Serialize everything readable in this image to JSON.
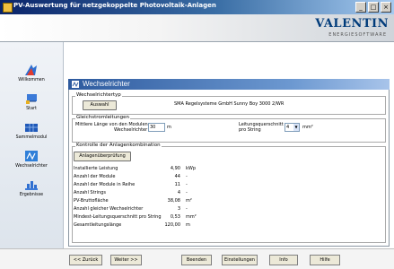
{
  "window": {
    "title": "PV-Auswertung für netzgekoppelte Photovoltaik-Anlagen"
  },
  "brand": {
    "logo": "VALENTIN",
    "tagline": "ENERGIESOFTWARE"
  },
  "sidebar": {
    "items": [
      {
        "label": "Willkommen",
        "icon": "welcome-icon"
      },
      {
        "label": "Start",
        "icon": "start-icon"
      },
      {
        "label": "Sammelmodul",
        "icon": "module-icon"
      },
      {
        "label": "Wechselrichter",
        "icon": "inverter-icon"
      },
      {
        "label": "Ergebnisse",
        "icon": "results-icon"
      }
    ]
  },
  "main": {
    "title": "Wechselrichter",
    "inverter_type": {
      "group_label": "Wechselrichtertyp",
      "select_button": "Auswahl",
      "selected_text": "SMA Regelsysteme GmbH Sunny Boy 3000 2/WR"
    },
    "cable": {
      "group_label": "Gleichstromleitungen",
      "length_label_1": "Mittlere Länge von den Modulen zum",
      "length_label_2": "Wechselrichter",
      "length_value": "30",
      "length_unit": "m",
      "cross_label_1": "Leitungsquerschnitt",
      "cross_label_2": "pro String",
      "cross_value": "4",
      "cross_unit": "mm²"
    },
    "check": {
      "group_label": "Kontrolle der Anlagenkombination",
      "button": "Anlagenüberprüfung"
    },
    "results": [
      {
        "label": "Installierte Leistung",
        "value": "4,90",
        "unit": "kWp"
      },
      {
        "label": "Anzahl der Module",
        "value": "44",
        "unit": "-"
      },
      {
        "label": "Anzahl der Module in Reihe",
        "value": "11",
        "unit": "-"
      },
      {
        "label": "Anzahl Strings",
        "value": "4",
        "unit": "-"
      },
      {
        "label": "PV-Bruttofläche",
        "value": "38,08",
        "unit": "m²"
      },
      {
        "label": "Anzahl gleicher Wechselrichter",
        "value": "3",
        "unit": "-"
      },
      {
        "label": "Mindest-Leitungsquerschnitt pro String",
        "value": "0,53",
        "unit": "mm²"
      },
      {
        "label": "Gesamtleitungslänge",
        "value": "120,00",
        "unit": "m"
      }
    ]
  },
  "footer": {
    "back": "<< Zurück",
    "next": "Weiter >>",
    "finish": "Beenden",
    "settings": "Einstellungen",
    "info": "Info",
    "help": "Hilfe"
  }
}
